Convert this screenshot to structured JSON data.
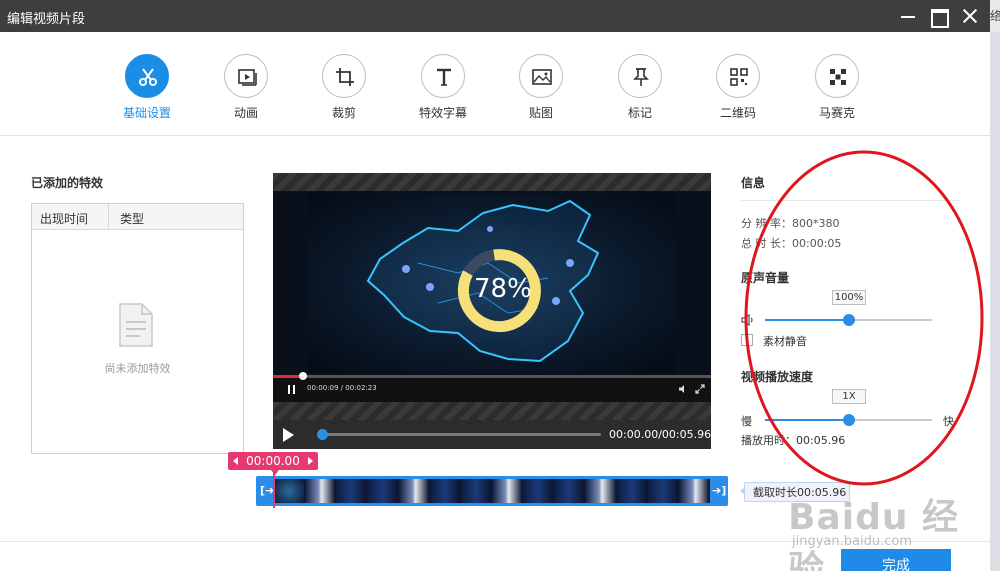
{
  "window": {
    "title": "编辑视频片段",
    "edge_cut_text": "络"
  },
  "toolbar": {
    "tools": [
      {
        "label": "基础设置",
        "icon": "scissors-icon",
        "active": true
      },
      {
        "label": "动画",
        "icon": "play-frame-icon"
      },
      {
        "label": "裁剪",
        "icon": "crop-icon"
      },
      {
        "label": "特效字幕",
        "icon": "text-icon"
      },
      {
        "label": "贴图",
        "icon": "image-icon"
      },
      {
        "label": "标记",
        "icon": "pin-icon"
      },
      {
        "label": "二维码",
        "icon": "qrcode-icon"
      },
      {
        "label": "马赛克",
        "icon": "mosaic-icon"
      }
    ]
  },
  "effects": {
    "title": "已添加的特效",
    "col_time": "出现时间",
    "col_type": "类型",
    "empty_text": "尚未添加特效"
  },
  "player": {
    "overlay_percent": "78%",
    "inner_time": "00:00:09 / 00:02:23",
    "time_display": "00:00.00/00:05.96",
    "progress": 0.0
  },
  "timeline": {
    "playhead_time": "00:00.00",
    "in_handle": "[➔",
    "out_handle": "➔]",
    "cut_duration": "截取时长00:05.96",
    "frame_count": 14
  },
  "info": {
    "title": "信息",
    "resolution_label": "分 辨 率：",
    "resolution_value": "800*380",
    "duration_label": "总 时 长：",
    "duration_value": "00:00:05",
    "volume_title": "原声音量",
    "volume_value": "100%",
    "volume_level": 0.5,
    "mute_label": "素材静音",
    "speed_title": "视频播放速度",
    "speed_value": "1X",
    "speed_slow": "慢",
    "speed_fast": "快",
    "speed_level": 0.5,
    "play_time_label": "播放用时：",
    "play_time_value": "00:05.96"
  },
  "footer": {
    "done_label": "完成"
  },
  "watermark": {
    "text": "Baidu 经验",
    "sub": "jingyan.baidu.com"
  },
  "colors": {
    "accent": "#1a8ee5",
    "playhead": "#e6396f",
    "annotation": "#e0161d"
  }
}
